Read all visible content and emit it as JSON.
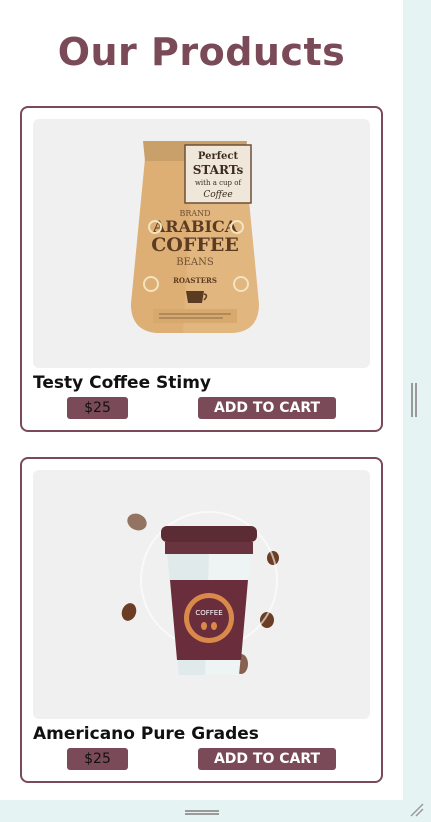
{
  "header": {
    "title": "Our Products"
  },
  "products": [
    {
      "name": "Testy Coffee Stimy",
      "price": "$25",
      "cta": "ADD TO CART",
      "image_text": {
        "tag1": "Perfect",
        "tag2": "STARTs",
        "tag3": "with a cup of",
        "tag4": "Coffee",
        "brand": "BRAND",
        "line1": "ARABICA",
        "line2": "COFFEE",
        "line3": "BEANS",
        "roasters": "ROASTERS"
      }
    },
    {
      "name": "Americano Pure Grades",
      "price": "$25",
      "cta": "ADD TO CART",
      "image_text": {
        "label": "COFFEE"
      }
    }
  ],
  "colors": {
    "accent": "#7a4a58",
    "card_image_bg": "#f0f0f0",
    "frame": "#e6f3f3"
  }
}
